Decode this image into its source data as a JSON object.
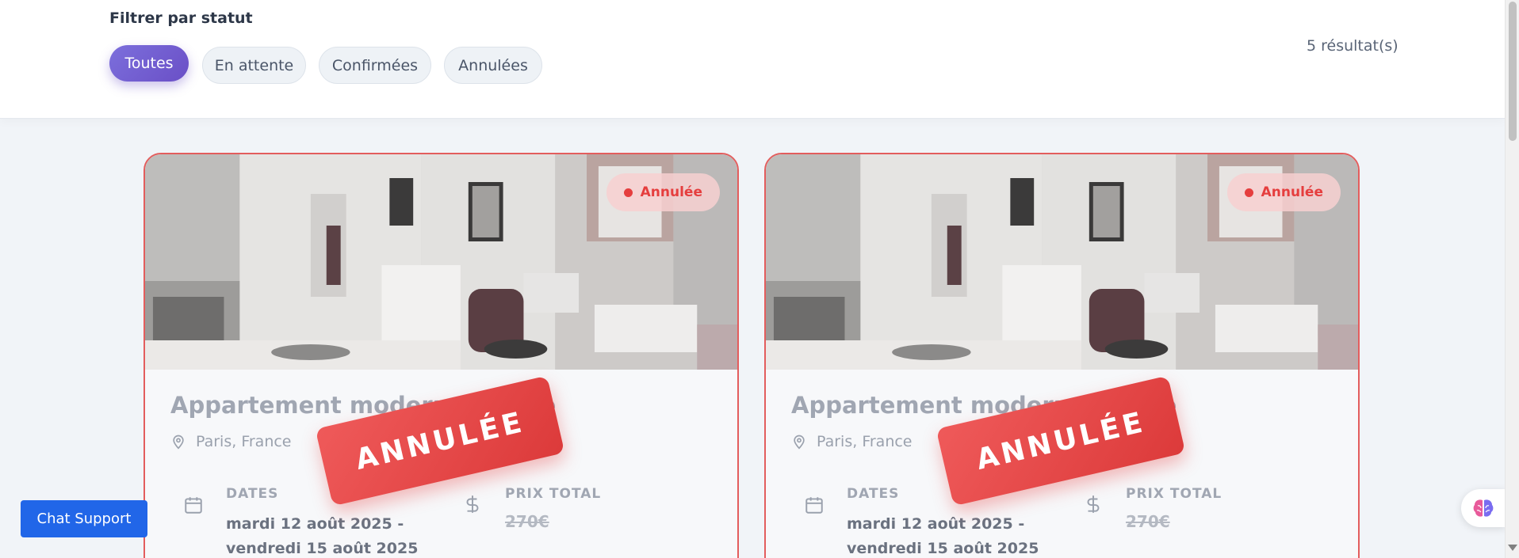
{
  "filter": {
    "title": "Filtrer par statut",
    "chips": [
      {
        "label": "Toutes",
        "active": true
      },
      {
        "label": "En attente",
        "active": false
      },
      {
        "label": "Confirmées",
        "active": false
      },
      {
        "label": "Annulées",
        "active": false
      }
    ],
    "result_count": "5 résultat(s)"
  },
  "cards": [
    {
      "status": "Annulée",
      "title": "Appartement moderne centre",
      "location": "Paris, France",
      "dates_label": "DATES",
      "dates_line1": "mardi 12 août 2025 -",
      "dates_line2": "vendredi 15 août 2025",
      "price_label": "PRIX TOTAL",
      "price_value": "270€",
      "stamp": "ANNULÉE"
    },
    {
      "status": "Annulée",
      "title": "Appartement moderne centre",
      "location": "Paris, France",
      "dates_label": "DATES",
      "dates_line1": "mardi 12 août 2025 -",
      "dates_line2": "vendredi 15 août 2025",
      "price_label": "PRIX TOTAL",
      "price_value": "270€",
      "stamp": "ANNULÉE"
    }
  ],
  "chat": {
    "label": "Chat Support"
  },
  "colors": {
    "accent": "#6a4fc6",
    "danger": "#e53e3e",
    "chat": "#2166e8"
  },
  "icons": [
    "map-pin-icon",
    "calendar-icon",
    "dollar-icon",
    "brain-icon"
  ]
}
